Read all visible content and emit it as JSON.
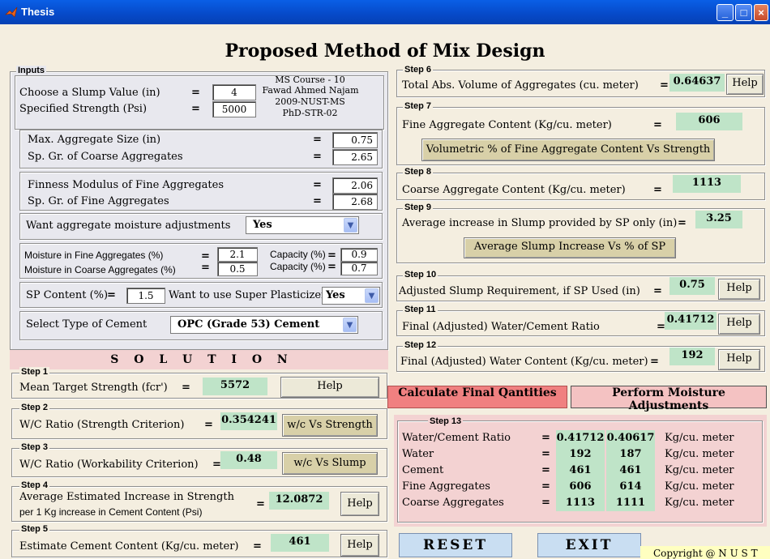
{
  "window": {
    "title": "Thesis"
  },
  "heading": "Proposed Method of Mix Design",
  "inputs": {
    "legend": "Inputs",
    "author": [
      "MS Course - 10",
      "Fawad Ahmed Najam",
      "2009-NUST-MS",
      "PhD-STR-02"
    ],
    "slump_label": "Choose a Slump Value (in)",
    "slump_value": "4",
    "strength_label": "Specified Strength (Psi)",
    "strength_value": "5000",
    "max_agg_label": "Max. Aggregate Size (in)",
    "max_agg_value": "0.75",
    "spgr_coarse_label": "Sp. Gr. of Coarse Aggregates",
    "spgr_coarse_value": "2.65",
    "fm_label": "Finness Modulus of Fine Aggregates",
    "fm_value": "2.06",
    "spgr_fine_label": "Sp. Gr. of Fine Aggregates",
    "spgr_fine_value": "2.68",
    "moisture_adj_label": "Want aggregate moisture adjustments",
    "moisture_adj_value": "Yes",
    "moist_fine_label": "Moisture in Fine Aggregates (%)",
    "moist_fine_value": "2.1",
    "moist_coarse_label": "Moisture in Coarse Aggregates (%)",
    "moist_coarse_value": "0.5",
    "capacity_label": "Capacity (%)",
    "cap_fine_value": "0.9",
    "cap_coarse_value": "0.7",
    "sp_label": "SP Content (%)",
    "sp_value": "1.5",
    "use_sp_label": "Want to use Super Plasticizer",
    "use_sp_value": "Yes",
    "cement_label": "Select Type of Cement",
    "cement_value": "OPC (Grade 53) Cement"
  },
  "solution_title": "S O L U T I O N",
  "steps": {
    "s1": {
      "legend": "Step 1",
      "label": "Mean Target Strength (fcr')",
      "value": "5572",
      "button": "Help"
    },
    "s2": {
      "legend": "Step 2",
      "label": "W/C Ratio (Strength Criterion)",
      "value": "0.354241",
      "button": "w/c Vs Strength"
    },
    "s3": {
      "legend": "Step 3",
      "label": "W/C Ratio (Workability Criterion)",
      "value": "0.48",
      "button": "w/c Vs Slump"
    },
    "s4": {
      "legend": "Step 4",
      "label1": "Average Estimated Increase in Strength",
      "label2": "per 1 Kg increase in Cement Content (Psi)",
      "value": "12.0872",
      "button": "Help"
    },
    "s5": {
      "legend": "Step 5",
      "label": "Estimate Cement Content (Kg/cu. meter)",
      "value": "461",
      "button": "Help"
    },
    "s6": {
      "legend": "Step 6",
      "label": "Total Abs. Volume of Aggregates (cu. meter)",
      "value": "0.64637",
      "button": "Help"
    },
    "s7": {
      "legend": "Step 7",
      "label": "Fine Aggregate Content (Kg/cu. meter)",
      "value": "606",
      "button": "Volumetric % of Fine Aggregate Content Vs Strength"
    },
    "s8": {
      "legend": "Step 8",
      "label": "Coarse Aggregate Content (Kg/cu. meter)",
      "value": "1113"
    },
    "s9": {
      "legend": "Step 9",
      "label": "Average increase in Slump provided by SP only (in)",
      "value": "3.25",
      "button": "Average Slump Increase Vs % of SP"
    },
    "s10": {
      "legend": "Step 10",
      "label": "Adjusted Slump Requirement, if SP Used (in)",
      "value": "0.75",
      "button": "Help"
    },
    "s11": {
      "legend": "Step 11",
      "label": "Final (Adjusted) Water/Cement Ratio",
      "value": "0.41712",
      "button": "Help"
    },
    "s12": {
      "legend": "Step 12",
      "label": "Final (Adjusted) Water Content (Kg/cu. meter)",
      "value": "192",
      "button": "Help"
    }
  },
  "eq": "=",
  "actions": {
    "calculate": "Calculate Final Qantities",
    "moisture": "Perform Moisture Adjustments",
    "reset": "RESET",
    "exit": "EXIT"
  },
  "step13": {
    "legend": "Step 13",
    "rows": [
      {
        "name": "Water/Cement Ratio",
        "v1": "0.41712",
        "v2": "0.40617",
        "unit": "Kg/cu. meter"
      },
      {
        "name": "Water",
        "v1": "192",
        "v2": "187",
        "unit": "Kg/cu. meter"
      },
      {
        "name": "Cement",
        "v1": "461",
        "v2": "461",
        "unit": "Kg/cu. meter"
      },
      {
        "name": "Fine Aggregates",
        "v1": "606",
        "v2": "614",
        "unit": "Kg/cu. meter"
      },
      {
        "name": "Coarse Aggregates",
        "v1": "1113",
        "v2": "1111",
        "unit": "Kg/cu. meter"
      }
    ]
  },
  "copyright": "Copyright @ N U S T",
  "colors": {
    "titlebar": "#0649C8",
    "result_bg": "#BFE4C8",
    "pink_bg": "#F3D2D2",
    "calc_btn": "#F08080",
    "moist_btn": "#F4C2C2",
    "blue_btn": "#C9DEF2",
    "copyright_bg": "#FFFFC0"
  }
}
